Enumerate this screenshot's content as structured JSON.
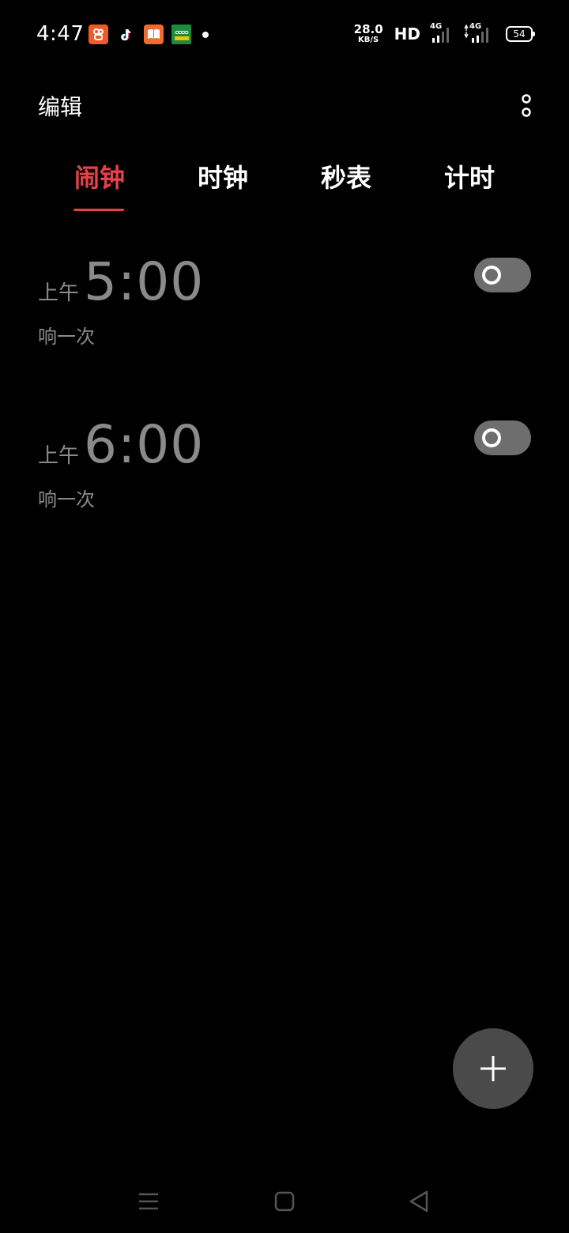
{
  "status_bar": {
    "time": "4:47",
    "net_speed_value": "28.0",
    "net_speed_unit": "KB/S",
    "hd_label": "HD",
    "signal_1_label": "4G",
    "signal_2_label": "4G",
    "battery_level": "54"
  },
  "app_bar": {
    "edit_label": "编辑"
  },
  "tabs": [
    {
      "label": "闹钟",
      "active": true
    },
    {
      "label": "时钟",
      "active": false
    },
    {
      "label": "秒表",
      "active": false
    },
    {
      "label": "计时",
      "active": false
    }
  ],
  "alarms": [
    {
      "period": "上午",
      "time": "5:00",
      "repeat": "响一次",
      "enabled": false
    },
    {
      "period": "上午",
      "time": "6:00",
      "repeat": "响一次",
      "enabled": false
    }
  ],
  "colors": {
    "accent": "#e8404a",
    "background": "#000000",
    "muted_text": "#8a8a8a",
    "toggle_off": "#6e6e6e",
    "fab": "#4a4a4a"
  },
  "icons": {
    "notifications": [
      "kuaishou-app-icon",
      "tiktok-app-icon",
      "book-app-icon",
      "oppo-app-icon"
    ],
    "more": "more-vertical-icon",
    "fab": "plus-icon",
    "nav": [
      "menu-icon",
      "home-icon",
      "back-icon"
    ]
  }
}
